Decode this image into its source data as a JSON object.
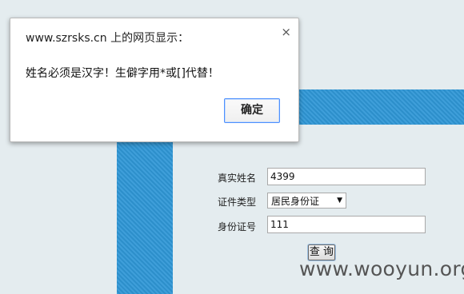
{
  "dialog": {
    "title": "www.szrsks.cn 上的网页显示：",
    "close_glyph": "×",
    "message": "姓名必须是汉字！生僻字用*或[]代替！",
    "ok_label": "确定"
  },
  "form": {
    "name_label": "真实姓名",
    "name_value": "4399",
    "idtype_label": "证件类型",
    "idtype_selected": "居民身份证",
    "idnum_label": "身份证号",
    "idnum_value": "111",
    "query_label": "查 询"
  },
  "watermark": "www.wooyun.org",
  "colors": {
    "stripe": "#2f97d6",
    "background": "#e4ecef",
    "focus": "#4d90fe"
  }
}
